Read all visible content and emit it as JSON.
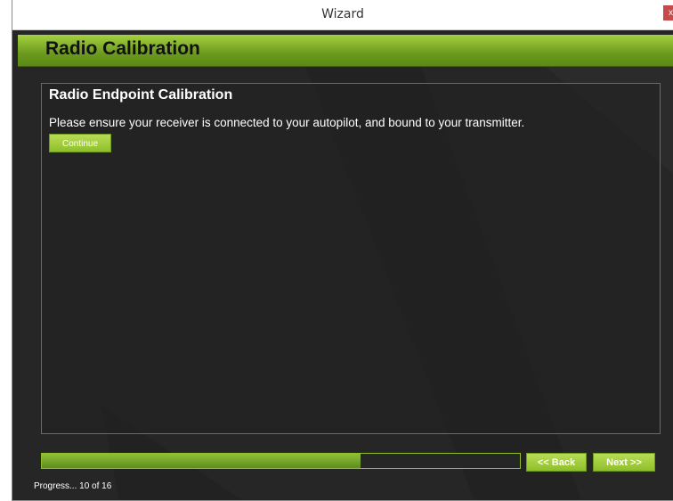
{
  "window": {
    "title": "Wizard",
    "close_glyph": "x"
  },
  "header": {
    "title": "Radio Calibration"
  },
  "panel": {
    "title": "Radio Endpoint Calibration",
    "message": "Please ensure your receiver is connected to your autopilot, and bound to your transmitter.",
    "continue_label": "Continue"
  },
  "nav": {
    "back_label": "<< Back",
    "next_label": "Next >>"
  },
  "progress": {
    "current": 10,
    "total": 16,
    "fraction": 0.667,
    "label": "Progress... 10 of 16"
  },
  "colors": {
    "accent": "#8fbf2b",
    "header_top": "#a5d041",
    "background": "#262626",
    "close": "#c74a4a"
  },
  "icons": {
    "close": "close-icon"
  }
}
